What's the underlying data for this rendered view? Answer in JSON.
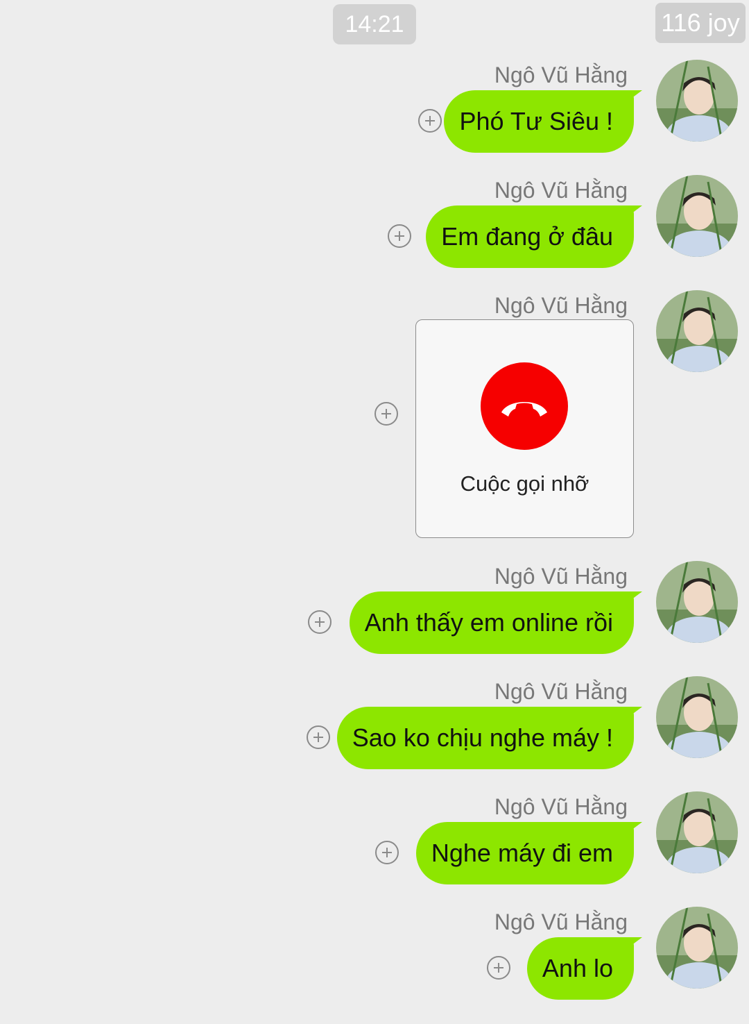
{
  "header": {
    "time": "14:21",
    "watermark": "116 joy"
  },
  "messages": [
    {
      "sender": "Ngô Vũ Hằng",
      "type": "text",
      "text": "Phó Tư Siêu !"
    },
    {
      "sender": "Ngô Vũ Hằng",
      "type": "text",
      "text": "Em đang ở đâu"
    },
    {
      "sender": "Ngô Vũ Hằng",
      "type": "call",
      "text": "Cuộc gọi nhỡ",
      "icon": "hang-up-phone-icon"
    },
    {
      "sender": "Ngô Vũ Hằng",
      "type": "text",
      "text": "Anh thấy em online rồi"
    },
    {
      "sender": "Ngô Vũ Hằng",
      "type": "text",
      "text": "Sao ko chịu nghe máy !"
    },
    {
      "sender": "Ngô Vũ Hằng",
      "type": "text",
      "text": "Nghe máy đi em"
    },
    {
      "sender": "Ngô Vũ Hằng",
      "type": "text",
      "text": "Anh lo"
    }
  ],
  "colors": {
    "bubble": "#8de600",
    "background": "#ededed",
    "missed_call": "#f60000"
  }
}
